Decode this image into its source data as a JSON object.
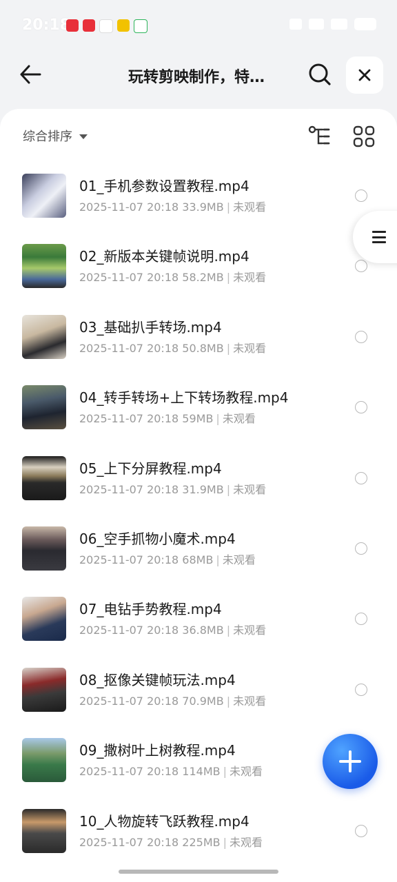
{
  "status_bar": {
    "time": "20:18",
    "notification_icons": [
      "xiaohongshu-icon",
      "app-icon",
      "baidu-icon",
      "mail-icon",
      "recycle-icon"
    ]
  },
  "header": {
    "title": "玩转剪映制作，特…",
    "back_icon": "arrow-left-icon",
    "search_icon": "search-icon",
    "close_icon": "close-icon"
  },
  "toolbar": {
    "sort_label": "综合排序"
  },
  "files": [
    {
      "name": "01_手机参数设置教程.mp4",
      "date": "2025-11-07 20:18",
      "size": "33.9MB",
      "status": "未观看"
    },
    {
      "name": "02_新版本关键帧说明.mp4",
      "date": "2025-11-07 20:18",
      "size": "58.2MB",
      "status": "未观看"
    },
    {
      "name": "03_基础扒手转场.mp4",
      "date": "2025-11-07 20:18",
      "size": "50.8MB",
      "status": "未观看"
    },
    {
      "name": "04_转手转场+上下转场教程.mp4",
      "date": "2025-11-07 20:18",
      "size": "59MB",
      "status": "未观看"
    },
    {
      "name": "05_上下分屏教程.mp4",
      "date": "2025-11-07 20:18",
      "size": "31.9MB",
      "status": "未观看"
    },
    {
      "name": "06_空手抓物小魔术.mp4",
      "date": "2025-11-07 20:18",
      "size": "68MB",
      "status": "未观看"
    },
    {
      "name": "07_电钻手势教程.mp4",
      "date": "2025-11-07 20:18",
      "size": "36.8MB",
      "status": "未观看"
    },
    {
      "name": "08_抠像关键帧玩法.mp4",
      "date": "2025-11-07 20:18",
      "size": "70.9MB",
      "status": "未观看"
    },
    {
      "name": "09_撒树叶上树教程.mp4",
      "date": "2025-11-07 20:18",
      "size": "114MB",
      "status": "未观看"
    },
    {
      "name": "10_人物旋转飞跃教程.mp4",
      "date": "2025-11-07 20:18",
      "size": "225MB",
      "status": "未观看"
    }
  ],
  "colors": {
    "accent": "#1a5be8",
    "background": "#f2f3f5",
    "sheet": "#ffffff",
    "text_primary": "#1a1a1a",
    "text_secondary": "#9a9a9a"
  }
}
